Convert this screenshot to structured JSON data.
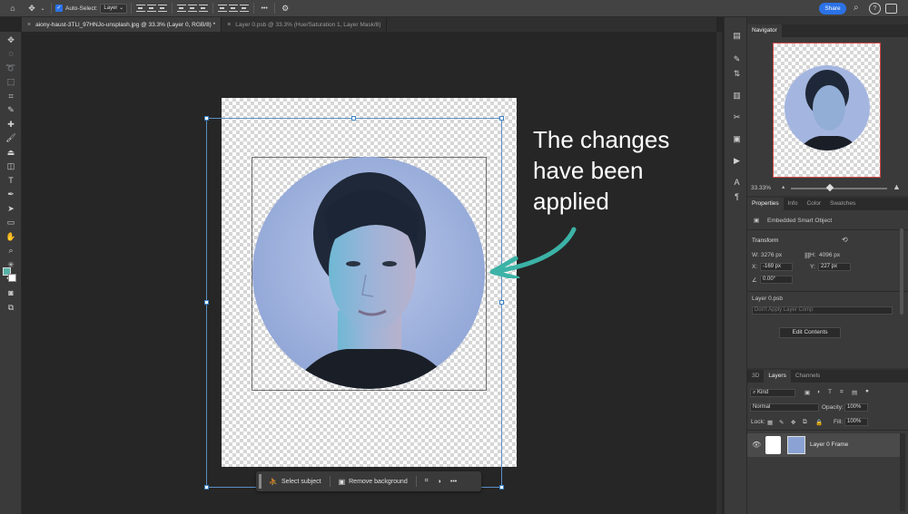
{
  "topbar": {
    "home_icon": "home-icon",
    "move_tool_icon": "move-icon",
    "auto_select_label": "Auto-Select:",
    "auto_select_value": "Layer",
    "more_label": "•••",
    "share_label": "Share"
  },
  "tabs": [
    {
      "label": "aiony-haust-3TLl_97HNJo-unsplash.jpg @ 33.3% (Layer 0, RGB/8) *",
      "close": "×"
    },
    {
      "label": "Layer 0.psb @ 33.3% (Hue/Saturation 1, Layer Mask/8)",
      "close": "×"
    }
  ],
  "canvas": {
    "annotation_lines": [
      "The changes",
      "have been",
      "applied"
    ],
    "accent_color": "#3bb3a6",
    "contextbar": {
      "select_subject": "Select subject",
      "remove_background": "Remove background",
      "more": "•••"
    }
  },
  "navigator": {
    "tab": "Navigator",
    "zoom": "33.33%"
  },
  "properties": {
    "tabs": [
      "Properties",
      "Info",
      "Color",
      "Swatches"
    ],
    "object_type": "Embedded Smart Object",
    "transform_label": "Transform",
    "w_label": "W:",
    "w_value": "3276 px",
    "h_label": "H:",
    "h_value": "4096 px",
    "x_label": "X:",
    "x_value": "-169 px",
    "y_label": "Y:",
    "y_value": "227 px",
    "angle_value": "0.00°",
    "linked_file": "Layer 0.psb",
    "layer_comp_placeholder": "Don't Apply Layer Comp",
    "edit_contents": "Edit Contents"
  },
  "layers": {
    "tabs": [
      "3D",
      "Layers",
      "Channels"
    ],
    "kind": "Kind",
    "blend_mode": "Normal",
    "opacity_label": "Opacity:",
    "opacity_value": "100%",
    "lock_label": "Lock:",
    "fill_label": "Fill:",
    "fill_value": "100%",
    "layer_name": "Layer 0 Frame"
  }
}
